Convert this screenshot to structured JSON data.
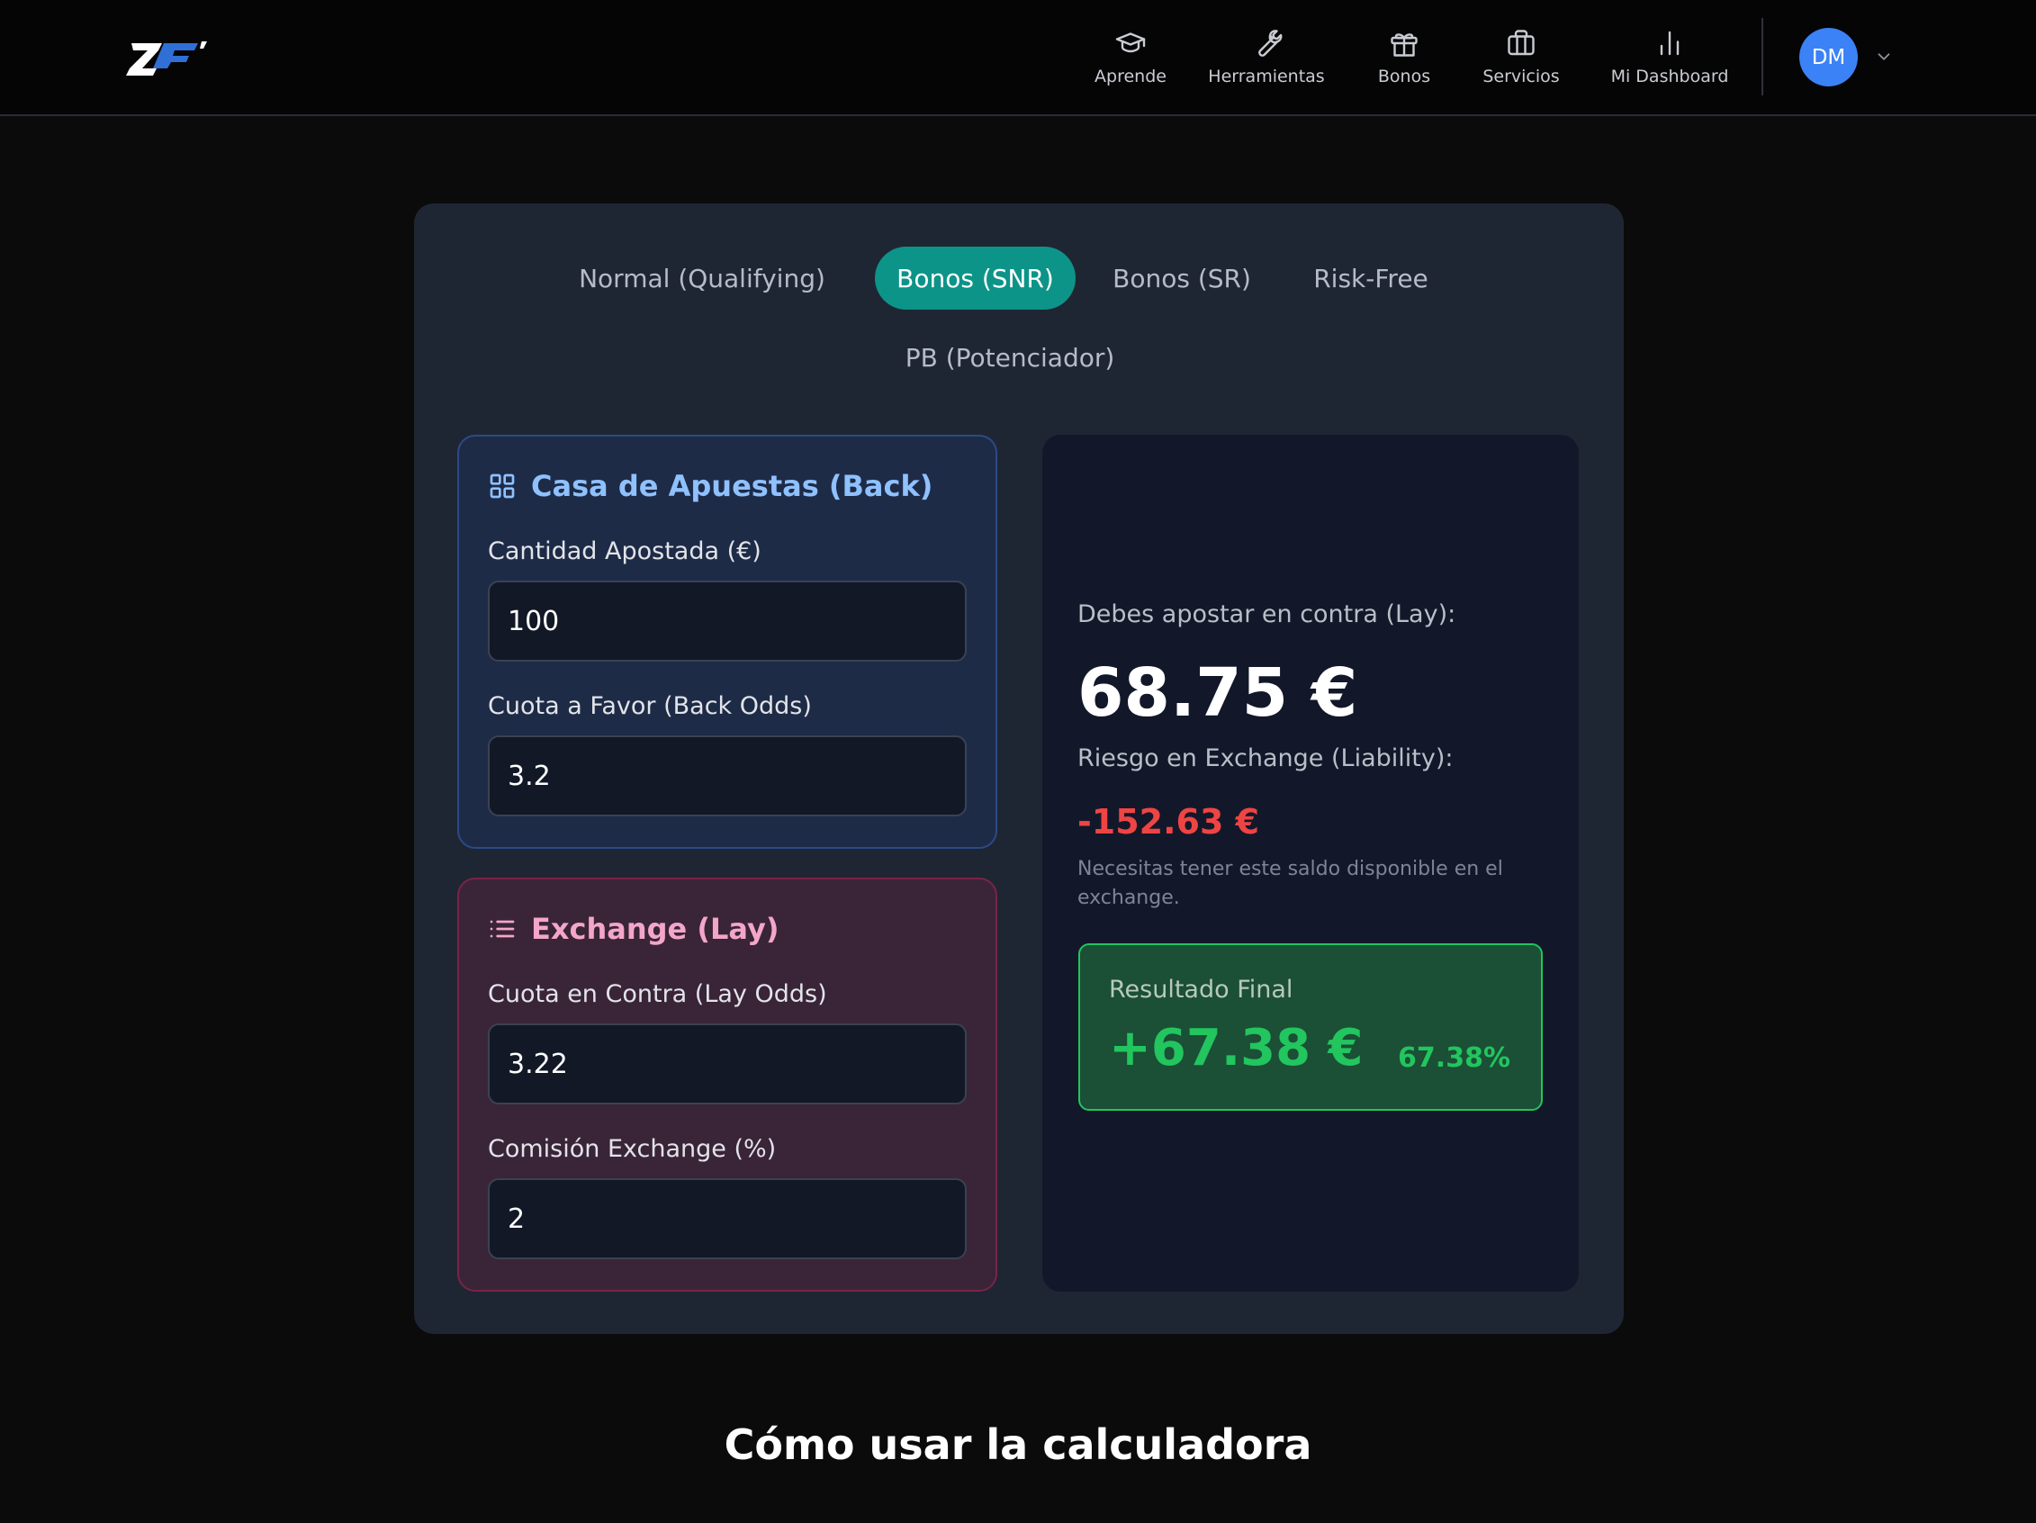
{
  "header": {
    "nav": [
      {
        "label": "Aprende",
        "icon": "graduation-cap-icon"
      },
      {
        "label": "Herramientas",
        "icon": "wrench-icon"
      },
      {
        "label": "Bonos",
        "icon": "gift-icon"
      },
      {
        "label": "Servicios",
        "icon": "briefcase-icon"
      },
      {
        "label": "Mi Dashboard",
        "icon": "bar-chart-icon"
      }
    ],
    "avatar_initials": "DM"
  },
  "tabs": [
    {
      "label": "Normal (Qualifying)",
      "active": false
    },
    {
      "label": "Bonos (SNR)",
      "active": true
    },
    {
      "label": "Bonos (SR)",
      "active": false
    },
    {
      "label": "Risk-Free",
      "active": false
    },
    {
      "label": "PB (Potenciador)",
      "active": false
    }
  ],
  "back_panel": {
    "title": "Casa de Apuestas (Back)",
    "stake_label": "Cantidad Apostada (€)",
    "stake_value": "100",
    "odds_label": "Cuota a Favor (Back Odds)",
    "odds_value": "3.2"
  },
  "lay_panel": {
    "title": "Exchange (Lay)",
    "odds_label": "Cuota en Contra (Lay Odds)",
    "odds_value": "3.22",
    "commission_label": "Comisión Exchange (%)",
    "commission_value": "2"
  },
  "results": {
    "lay_label": "Debes apostar en contra (Lay):",
    "lay_amount": "68.75 €",
    "liability_label": "Riesgo en Exchange (Liability):",
    "liability_amount": "-152.63 €",
    "liability_note": "Necesitas tener este saldo disponible en el exchange.",
    "final_label": "Resultado Final",
    "final_amount": "+67.38 €",
    "final_percent": "67.38%"
  },
  "section": {
    "heading": "Cómo usar la calculadora"
  },
  "colors": {
    "accent": "#0d9488",
    "back_accent": "#8fc1ff",
    "lay_accent": "#f3a6c8",
    "negative": "#ef4444",
    "positive": "#22c55e",
    "avatar": "#3b82f6"
  }
}
